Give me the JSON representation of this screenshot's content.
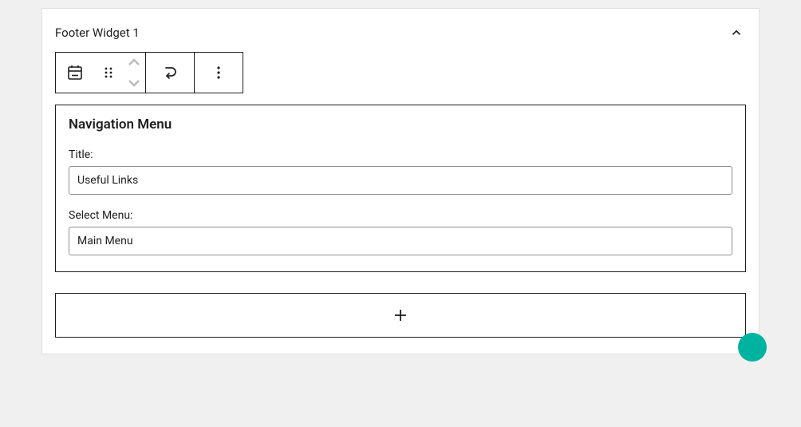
{
  "panel": {
    "title": "Footer Widget 1"
  },
  "widget": {
    "name": "Navigation Menu",
    "title_label": "Title:",
    "title_value": "Useful Links",
    "select_label": "Select Menu:",
    "select_value": "Main Menu"
  }
}
